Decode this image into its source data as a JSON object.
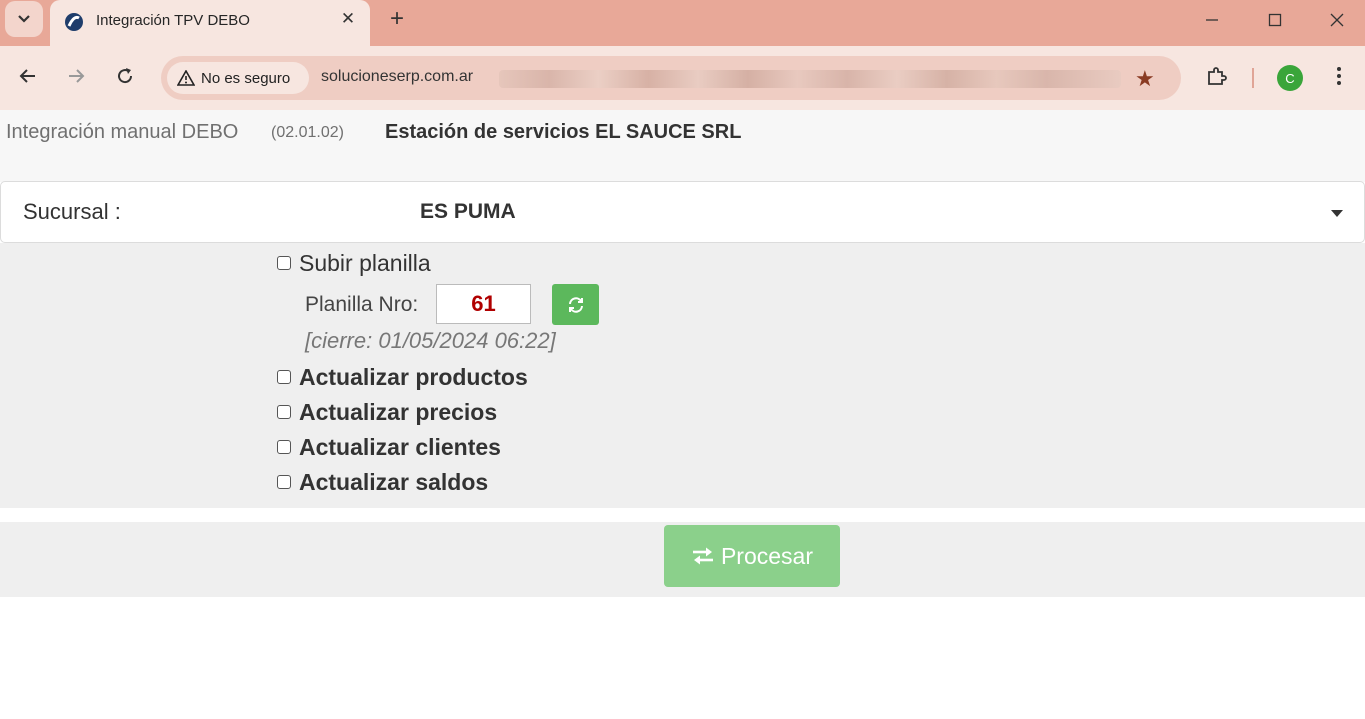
{
  "browser": {
    "tab": {
      "title": "Integración TPV DEBO"
    },
    "security_label": "No es seguro",
    "url_visible": "solucioneserp.com.ar",
    "profile_initial": "C",
    "colors": {
      "tabbar": "#e8a898",
      "toolbar": "#f7e6e0",
      "avatar": "#3aa53a"
    }
  },
  "header": {
    "app_name": "Integración manual DEBO",
    "version": "(02.01.02)",
    "company": "Estación de servicios EL SAUCE SRL"
  },
  "sucursal": {
    "label": "Sucursal :",
    "value": "ES PUMA"
  },
  "options": {
    "subir_planilla": {
      "label": "Subir planilla",
      "checked": false
    },
    "planilla_label": "Planilla Nro:",
    "planilla_value": "61",
    "cierre": "[cierre: 01/05/2024 06:22]",
    "productos": {
      "label": "Actualizar productos",
      "checked": false
    },
    "precios": {
      "label": "Actualizar precios",
      "checked": false
    },
    "clientes": {
      "label": "Actualizar clientes",
      "checked": false
    },
    "saldos": {
      "label": "Actualizar saldos",
      "checked": false
    }
  },
  "actions": {
    "procesar_label": "Procesar",
    "colors": {
      "procesar": "#8bd08b",
      "refresh": "#5cb85c",
      "planilla_value": "#b00000"
    }
  }
}
